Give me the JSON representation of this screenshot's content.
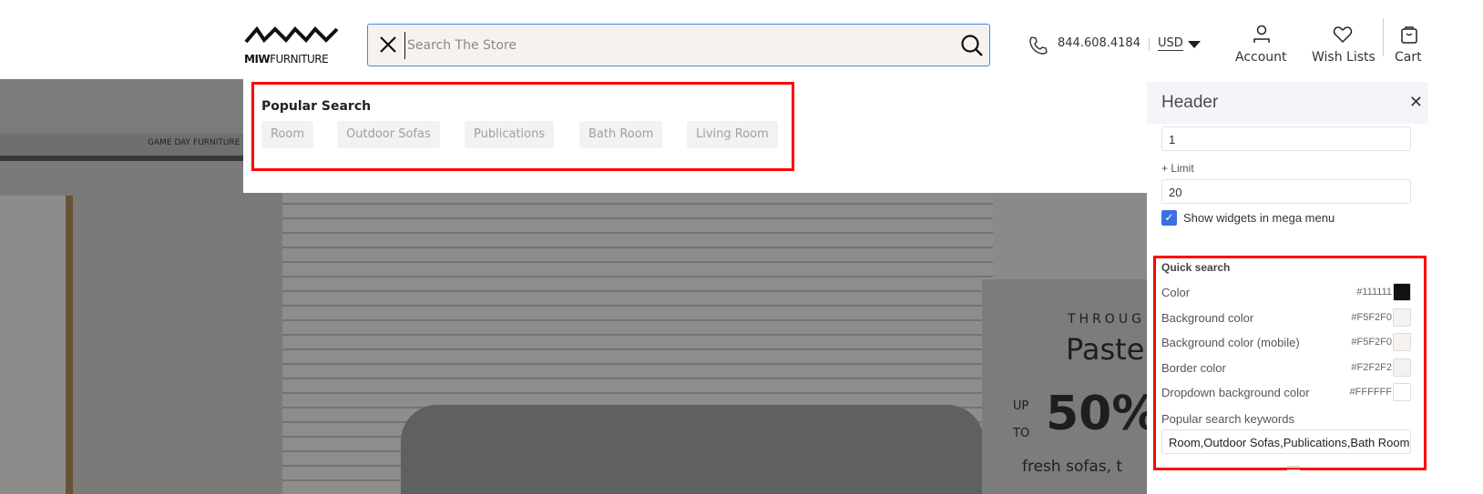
{
  "brand": {
    "logo_bold": "MIW",
    "logo_rest": "FURNITURE"
  },
  "search": {
    "placeholder": "Search The Store",
    "value": ""
  },
  "header": {
    "phone": "844.608.4184",
    "currency": "USD",
    "account": "Account",
    "wishlists": "Wish Lists",
    "cart": "Cart"
  },
  "nav": {
    "item": "GAME DAY FURNITURE"
  },
  "banner": {
    "line1": "THROUG",
    "line2": "Paste",
    "up": "UP",
    "to": "TO",
    "percent": "50%",
    "sub": "fresh sofas, t"
  },
  "popular": {
    "title": "Popular Search",
    "keywords": [
      "Room",
      "Outdoor Sofas",
      "Publications",
      "Bath Room",
      "Living Room"
    ]
  },
  "panel": {
    "title": "Header",
    "field1_value": "1",
    "limit_label": "+ Limit",
    "limit_value": "20",
    "show_widgets_label": "Show widgets in mega menu",
    "show_widgets_checked": true,
    "quick_search": {
      "title": "Quick search",
      "colors": [
        {
          "label": "Color",
          "hex": "#111111"
        },
        {
          "label": "Background color",
          "hex": "#F5F2F0"
        },
        {
          "label": "Background color (mobile)",
          "hex": "#F5F2F0"
        },
        {
          "label": "Border color",
          "hex": "#F2F2F2"
        },
        {
          "label": "Dropdown background color",
          "hex": "#FFFFFF"
        }
      ],
      "keywords_label": "Popular search keywords",
      "keywords_value": "Room,Outdoor Sofas,Publications,Bath Room,Living Room"
    }
  },
  "colors": {
    "accent": "#3a8ee6",
    "highlight": "#ff0000",
    "checkbox": "#3d6fe0"
  }
}
